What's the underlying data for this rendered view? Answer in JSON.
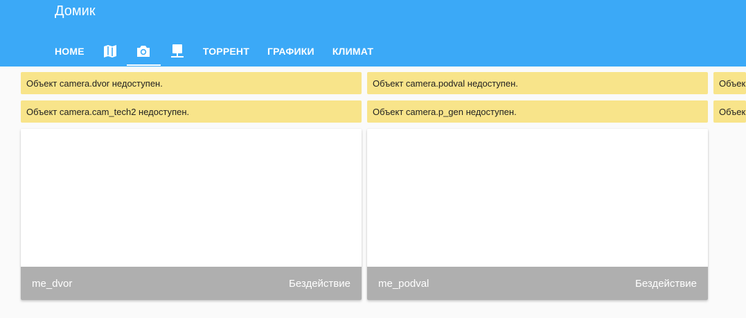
{
  "app": {
    "title": "Домик"
  },
  "tabs": [
    {
      "label": "HOME",
      "type": "text",
      "active": false
    },
    {
      "icon": "map-icon",
      "type": "icon",
      "active": false
    },
    {
      "icon": "camera-icon",
      "type": "icon",
      "active": true
    },
    {
      "icon": "monitor-icon",
      "type": "icon",
      "active": false
    },
    {
      "label": "ТОРРЕНТ",
      "type": "text",
      "active": false
    },
    {
      "label": "ГРАФИКИ",
      "type": "text",
      "active": false
    },
    {
      "label": "КЛИМАТ",
      "type": "text",
      "active": false
    }
  ],
  "warnings": [
    "Объект camera.dvor недоступен.",
    "Объект camera.podval недоступен.",
    "Объек",
    "Объект camera.cam_tech2 недоступен.",
    "Объект camera.p_gen недоступен.",
    "Объек"
  ],
  "cards": [
    {
      "name": "me_dvor",
      "state": "Бездействие"
    },
    {
      "name": "me_podval",
      "state": "Бездействие"
    }
  ],
  "colors": {
    "header": "#3ba9f7",
    "warning": "#f8e48a",
    "card_footer": "#afafaf",
    "background": "#fafafa"
  }
}
